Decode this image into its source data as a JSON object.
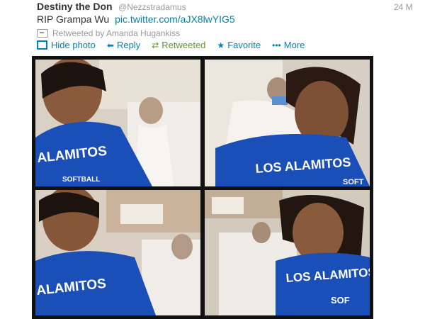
{
  "tweet": {
    "author_name": "Destiny the Don",
    "author_handle": "@Nezzstradamus",
    "timestamp": "24 M",
    "text": "RIP Grampa Wu",
    "link": "pic.twitter.com/aJX8lwYIG5",
    "retweeted_by": "Retweeted by Amanda Hugankiss"
  },
  "actions": {
    "hide_photo": "Hide photo",
    "reply": "Reply",
    "retweeted": "Retweeted",
    "favorite": "Favorite",
    "more": "More"
  },
  "photo": {
    "shirt_texts": [
      "ALAMITOS",
      "SOFTBALL",
      "LOS ALAMITOS",
      "SOFT",
      "ALAMITOS",
      "LOS ALAMITOS",
      "SOF"
    ]
  },
  "colors": {
    "link": "#0084b4",
    "retweeted": "#609928",
    "shirt_blue": "#1b4fb8"
  }
}
